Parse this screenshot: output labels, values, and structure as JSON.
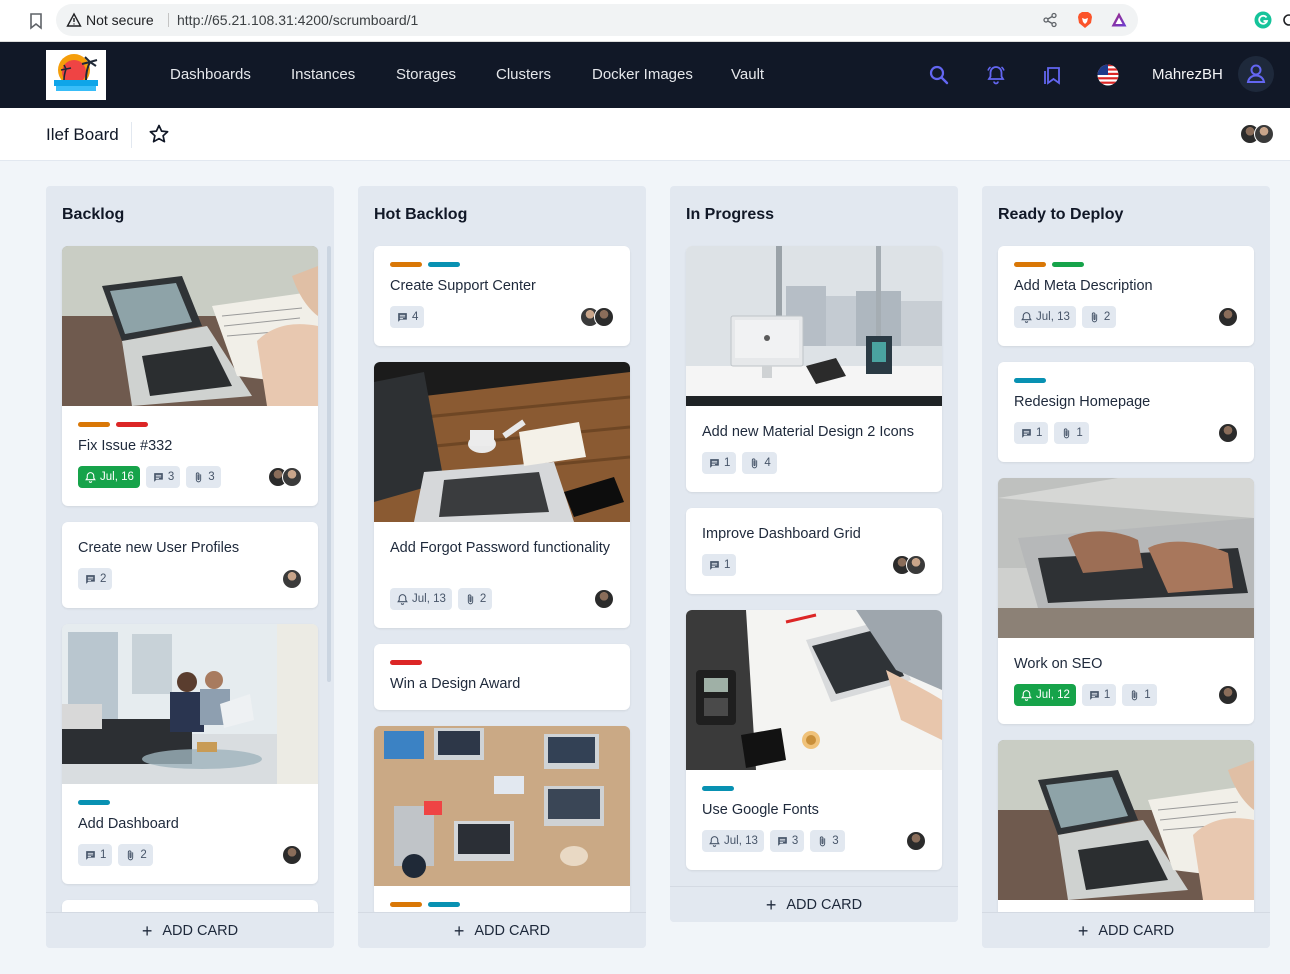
{
  "browser": {
    "security_label": "Not secure",
    "url": "http://65.21.108.31:4200/scrumboard/1"
  },
  "nav": {
    "items": [
      "Dashboards",
      "Instances",
      "Storages",
      "Clusters",
      "Docker Images",
      "Vault"
    ],
    "username": "MahrezBH"
  },
  "board": {
    "title": "Ilef Board"
  },
  "colors": {
    "header_bg": "#111827",
    "accent_icon": "#6366f1",
    "label_orange": "#d97706",
    "label_red": "#dc2626",
    "label_blue": "#0891b2",
    "label_green": "#16a34a",
    "due_badge": "#16a34a"
  },
  "add_card_label": "ADD CARD",
  "lists": [
    {
      "title": "Backlog",
      "cards": [
        {
          "image": "laptop-paperwork",
          "labels": [
            "orange",
            "red"
          ],
          "title": "Fix Issue #332",
          "due": "Jul, 16",
          "due_done": true,
          "comments": "3",
          "attachments": "3",
          "members": 2
        },
        {
          "title": "Create new User Profiles",
          "comments": "2",
          "members": 1
        },
        {
          "image": "office-meeting",
          "labels": [
            "blue"
          ],
          "title": "Add Dashboard",
          "comments": "1",
          "attachments": "2",
          "members": 1
        }
      ]
    },
    {
      "title": "Hot Backlog",
      "cards": [
        {
          "labels": [
            "orange",
            "blue"
          ],
          "title": "Create Support Center",
          "comments": "4",
          "members": 2
        },
        {
          "image": "desk-laptop-coffee",
          "title": "Add Forgot Password functionality",
          "due": "Jul, 13",
          "attachments": "2",
          "members": 1
        },
        {
          "labels": [
            "red"
          ],
          "title": "Win a Design Award"
        },
        {
          "image": "team-laptops",
          "labels": [
            "orange",
            "blue"
          ]
        }
      ]
    },
    {
      "title": "In Progress",
      "cards": [
        {
          "image": "imac-office",
          "title": "Add new Material Design 2 Icons",
          "comments": "1",
          "attachments": "4"
        },
        {
          "title": "Improve Dashboard Grid",
          "comments": "1",
          "members": 2
        },
        {
          "image": "desk-topdown",
          "labels": [
            "blue"
          ],
          "title": "Use Google Fonts",
          "due": "Jul, 13",
          "comments": "3",
          "attachments": "3",
          "members": 1
        }
      ]
    },
    {
      "title": "Ready to Deploy",
      "cards": [
        {
          "labels": [
            "orange",
            "green"
          ],
          "title": "Add Meta Description",
          "due": "Jul, 13",
          "attachments": "2",
          "members": 1
        },
        {
          "labels": [
            "blue"
          ],
          "title": "Redesign Homepage",
          "comments": "1",
          "attachments": "1",
          "members": 1
        },
        {
          "image": "typing-laptop",
          "title": "Work on SEO",
          "due": "Jul, 12",
          "due_done": true,
          "comments": "1",
          "attachments": "1",
          "members": 1
        },
        {
          "image": "laptop-paperwork"
        }
      ]
    }
  ]
}
